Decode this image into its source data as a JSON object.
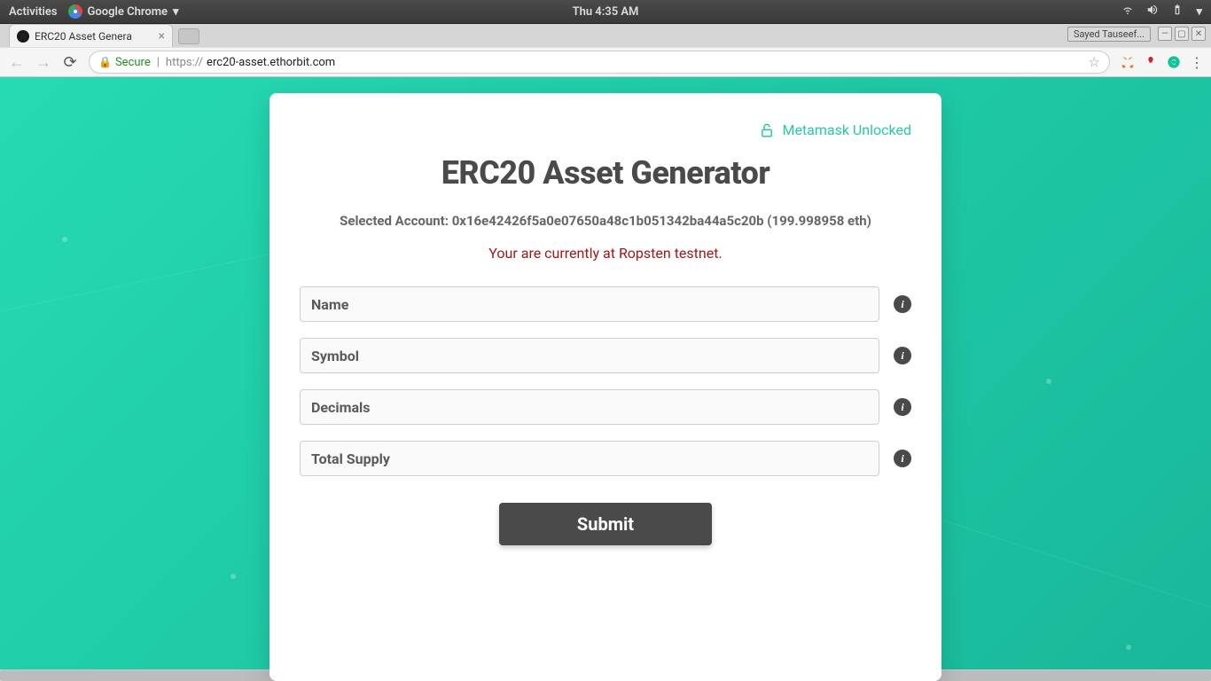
{
  "os": {
    "activities": "Activities",
    "app_name": "Google Chrome",
    "clock": "Thu  4:35 AM"
  },
  "browser": {
    "tab_title": "ERC20 Asset Genera",
    "user_badge": "Sayed Tauseef...",
    "secure_label": "Secure",
    "url_proto": "https://",
    "url_host": "erc20-asset.ethorbit.com"
  },
  "card": {
    "metamask_status": "Metamask Unlocked",
    "title": "ERC20 Asset Generator",
    "account_prefix": "Selected Account: ",
    "account_address": "0x16e42426f5a0e07650a48c1b051342ba44a5c20b",
    "account_balance": " (199.998958 eth)",
    "network_warning": "Your are currently at Ropsten testnet.",
    "fields": {
      "name": "Name",
      "symbol": "Symbol",
      "decimals": "Decimals",
      "total_supply": "Total Supply"
    },
    "submit": "Submit"
  }
}
